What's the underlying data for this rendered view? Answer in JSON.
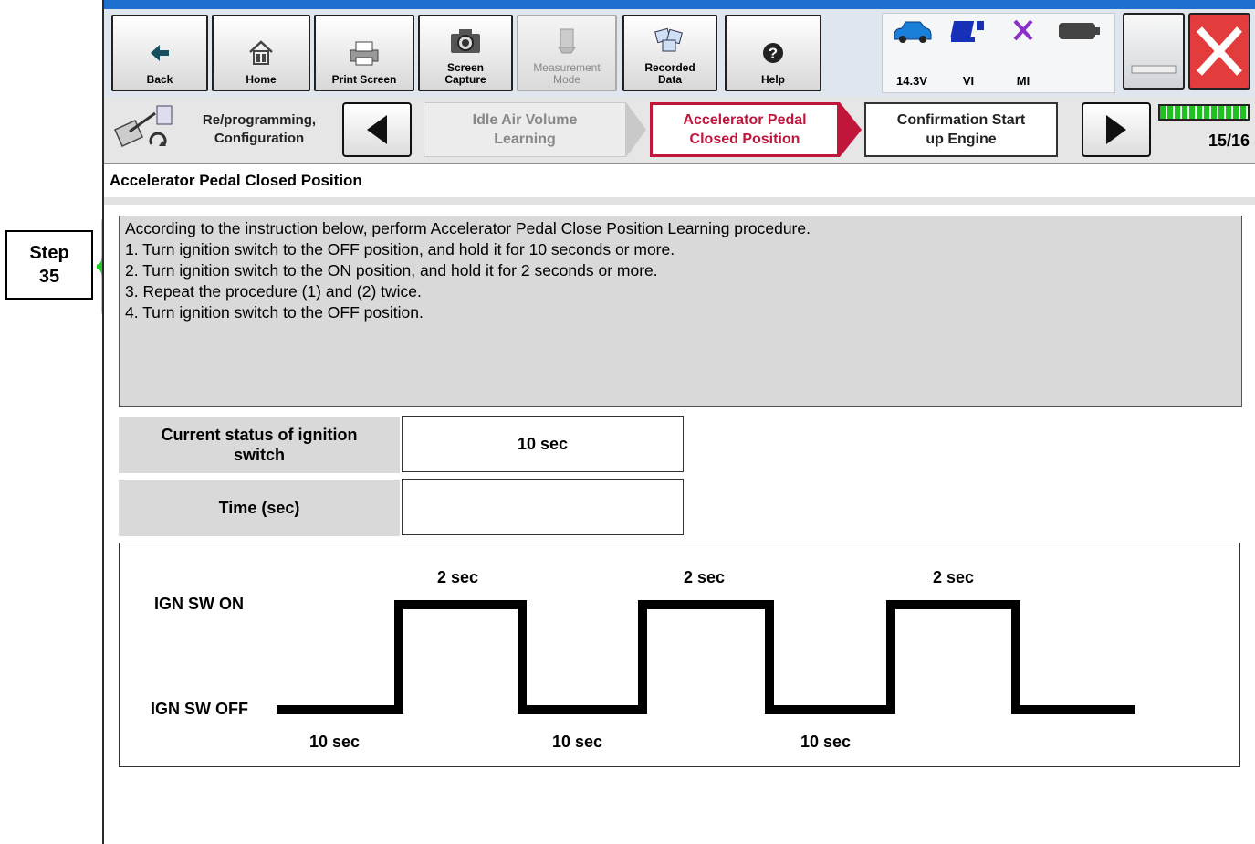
{
  "annotation": {
    "step_line1": "Step",
    "step_line2": "35"
  },
  "toolbar": {
    "buttons": [
      {
        "label": "Back",
        "icon": "back-arrow-icon"
      },
      {
        "label": "Home",
        "icon": "home-icon"
      },
      {
        "label": "Print Screen",
        "icon": "printer-icon"
      },
      {
        "label": "Screen\nCapture",
        "icon": "camera-icon"
      },
      {
        "label": "Measurement\nMode",
        "icon": "measurement-icon",
        "disabled": true
      },
      {
        "label": "Recorded\nData",
        "icon": "recorded-data-icon"
      },
      {
        "label": "Help",
        "icon": "help-icon"
      }
    ],
    "status": {
      "voltage": "14.3V",
      "vi": "VI",
      "mi": "MI"
    }
  },
  "navigation": {
    "title_line1": "Re/programming,",
    "title_line2": "Configuration",
    "prev_step_line1": "Idle Air Volume",
    "prev_step_line2": "Learning",
    "current_step_line1": "Accelerator Pedal",
    "current_step_line2": "Closed Position",
    "next_step_line1": "Confirmation Start",
    "next_step_line2": "up Engine",
    "progress": "15/16"
  },
  "page": {
    "title": "Accelerator Pedal Closed Position",
    "instructions": [
      "According to the instruction below, perform Accelerator Pedal Close Position Learning procedure.",
      "1. Turn ignition switch to the OFF position, and hold it for 10 seconds or more.",
      "2. Turn ignition switch to the ON position, and hold it for 2 seconds or more.",
      "3. Repeat the procedure (1) and (2) twice.",
      "4. Turn ignition switch to the OFF position."
    ],
    "status_rows": [
      {
        "label": "Current status of ignition switch",
        "value": "10 sec"
      },
      {
        "label": "Time (sec)",
        "value": ""
      }
    ]
  },
  "diagram": {
    "on_label": "IGN SW ON",
    "off_label": "IGN SW OFF",
    "on_durations": [
      "2 sec",
      "2 sec",
      "2 sec"
    ],
    "off_durations": [
      "10 sec",
      "10 sec",
      "10 sec"
    ]
  },
  "colors": {
    "accent": "#c0163c",
    "title_bar": "#1f6fd1",
    "highlight_brace": "#22cc22"
  }
}
